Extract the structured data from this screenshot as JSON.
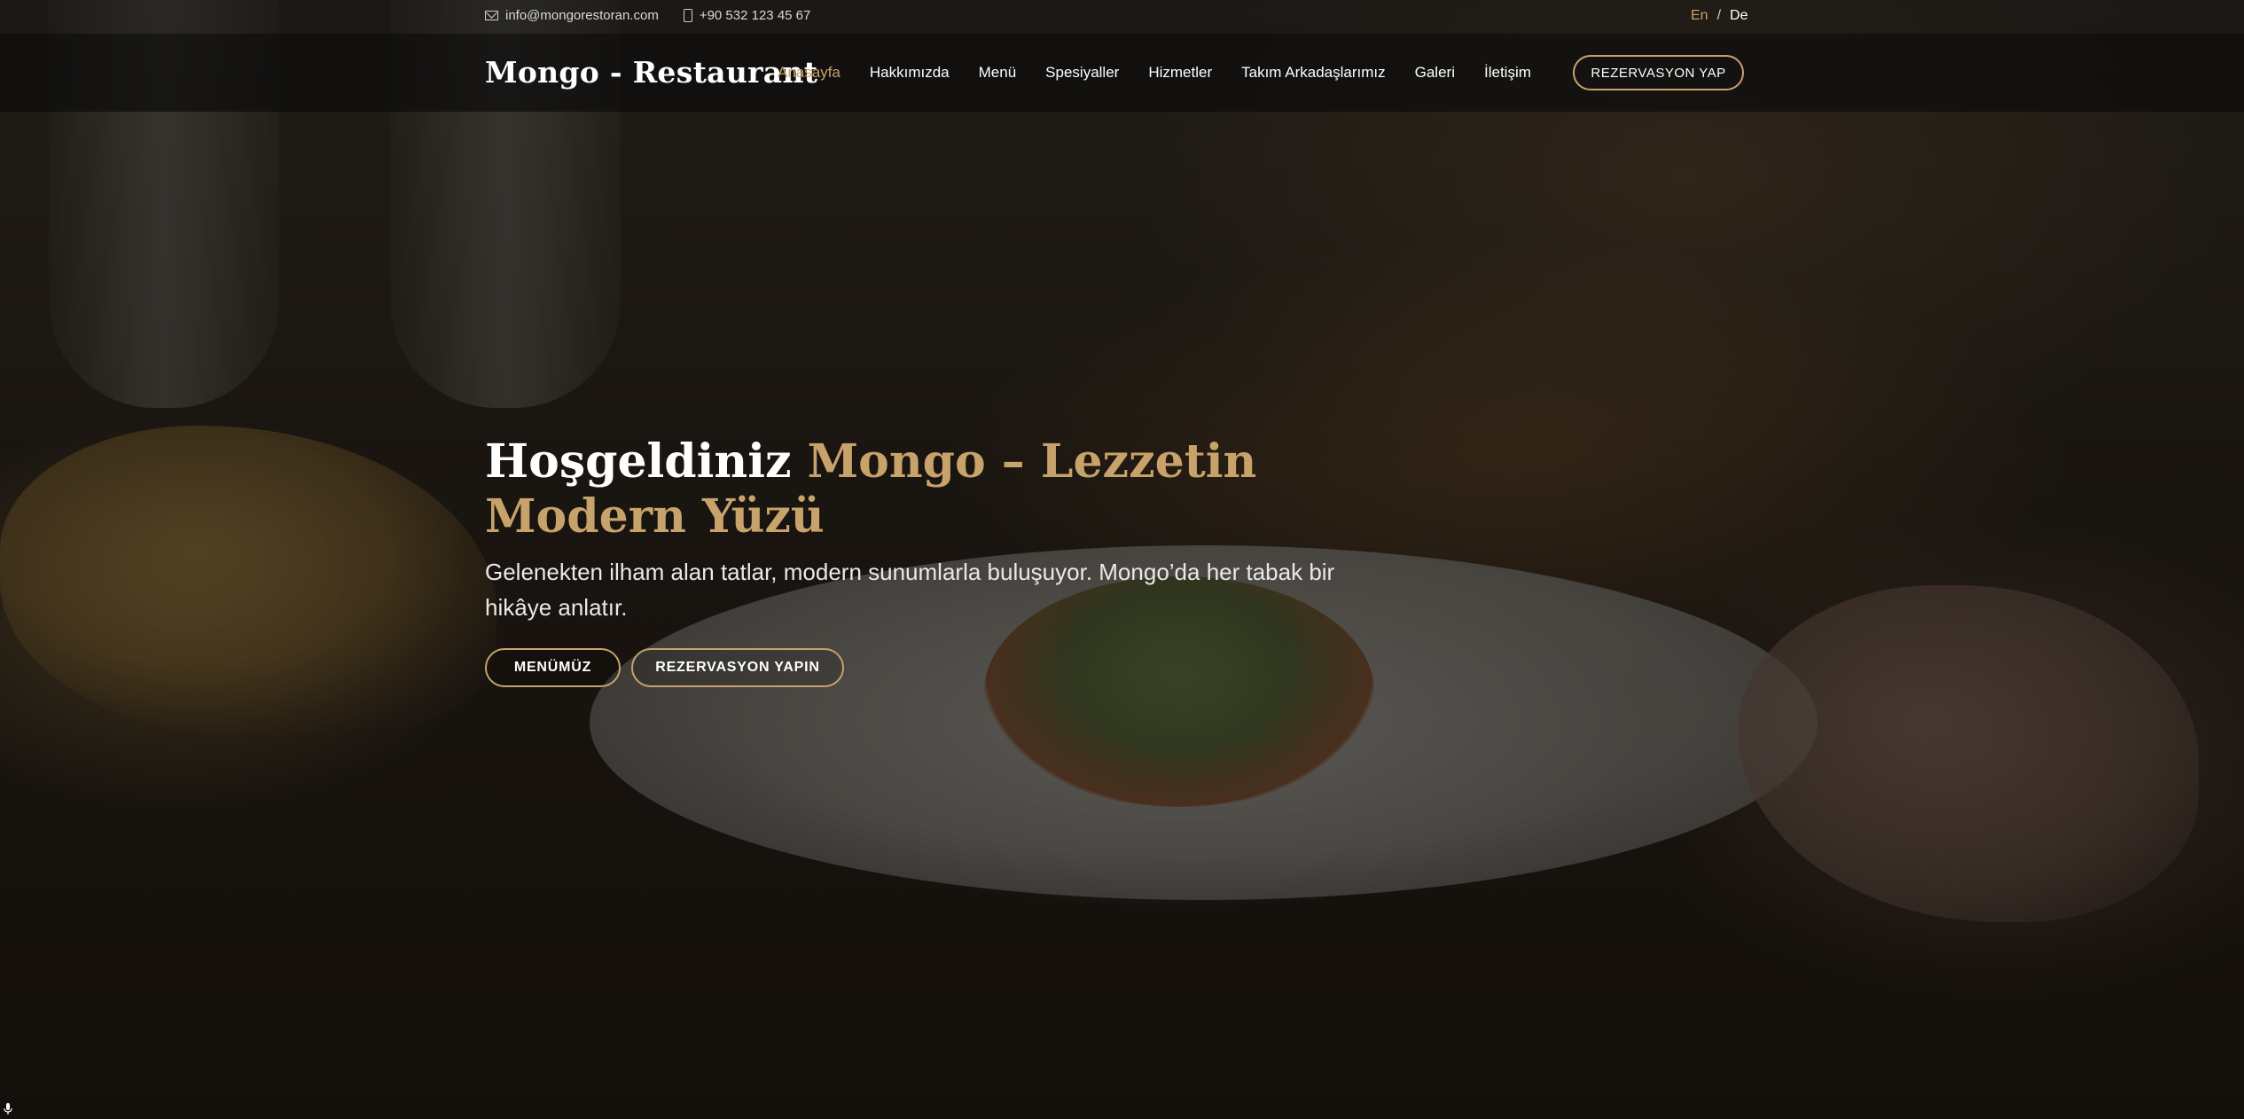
{
  "topbar": {
    "email": "info@mongorestoran.com",
    "phone": "+90 532 123 45 67",
    "lang_active": "En",
    "lang_separator": "/",
    "lang_other": "De"
  },
  "navbar": {
    "brand": "Mongo - Restaurant",
    "items": [
      {
        "label": "Anasayfa",
        "active": true
      },
      {
        "label": "Hakkımızda"
      },
      {
        "label": "Menü"
      },
      {
        "label": "Spesiyaller"
      },
      {
        "label": "Hizmetler"
      },
      {
        "label": "Takım Arkadaşlarımız"
      },
      {
        "label": "Galeri"
      },
      {
        "label": "İletişim"
      }
    ],
    "reserve_button": "REZERVASYON YAP"
  },
  "hero": {
    "title_prefix": "Hoşgeldiniz",
    "title_accent": "Mongo – Lezzetin Modern Yüzü",
    "subtitle": "Gelenekten ilham alan tatlar, modern sunumlarla buluşuyor. Mongo’da her tabak bir hikâye anlatır.",
    "menu_button": "MENÜMÜZ",
    "reserve_button": "REZERVASYON YAPIN"
  },
  "colors": {
    "accent": "#c8a26b",
    "nav_bg": "#0c0c0c"
  },
  "icons": [
    "mail-icon",
    "phone-icon",
    "microphone-icon"
  ]
}
